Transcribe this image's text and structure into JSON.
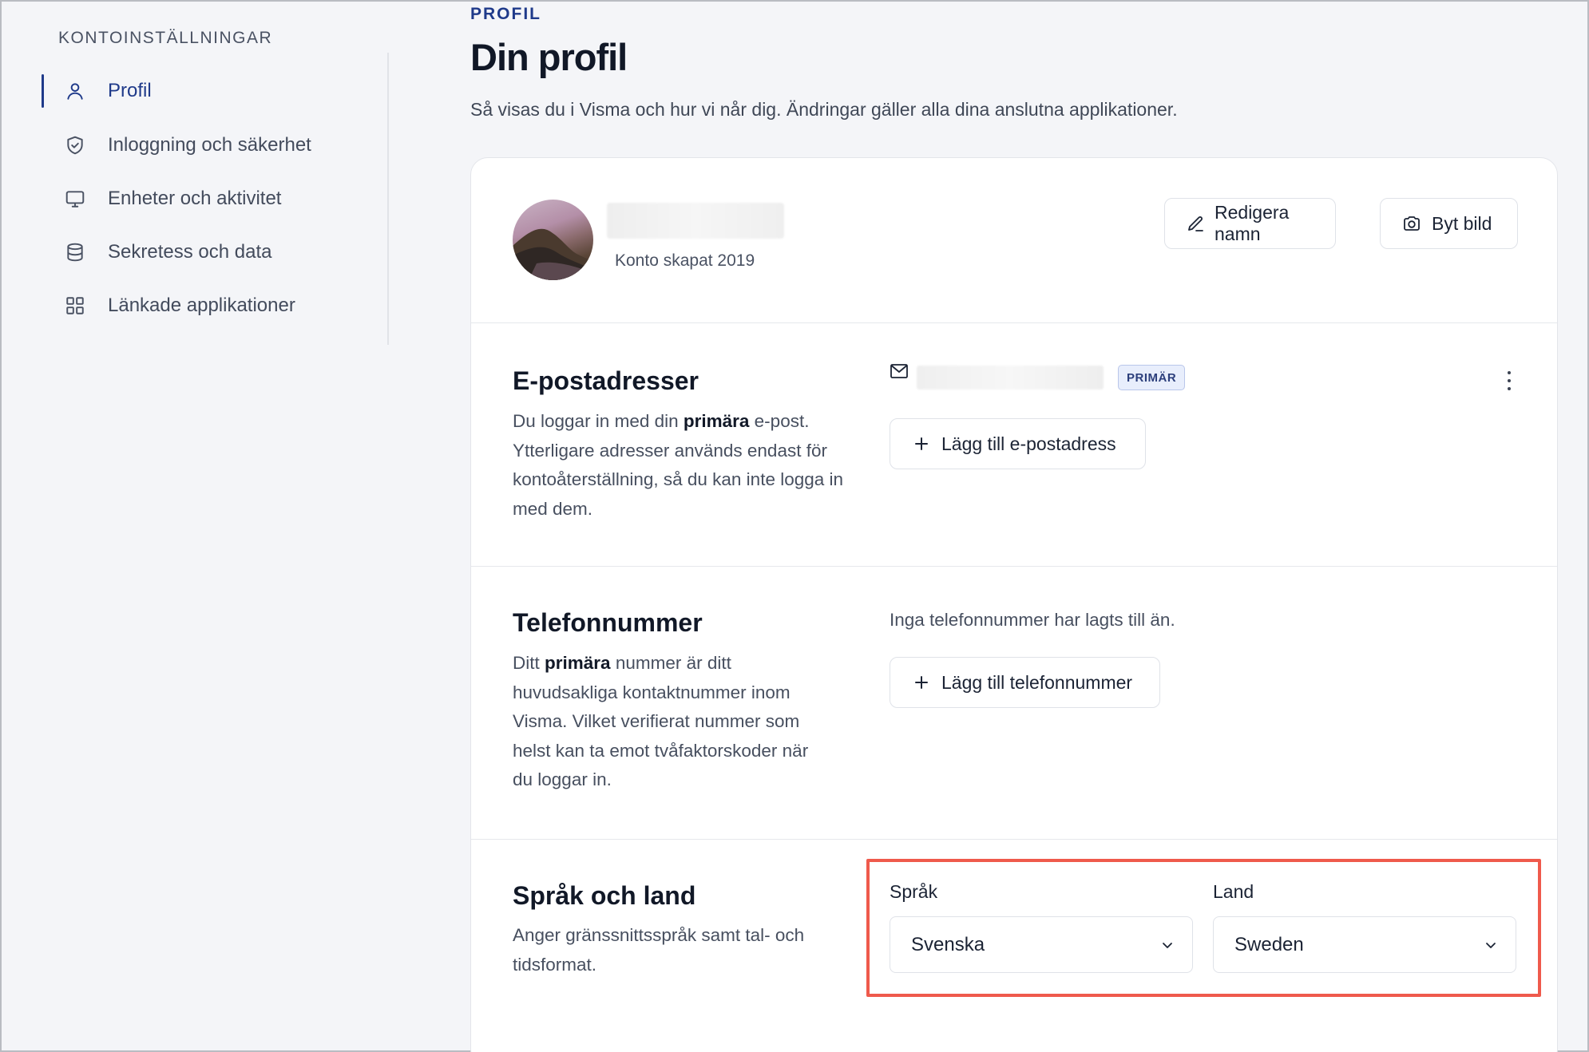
{
  "sidebar": {
    "heading": "KONTOINSTÄLLNINGAR",
    "items": [
      {
        "label": "Profil",
        "icon": "user-icon",
        "active": true
      },
      {
        "label": "Inloggning och säkerhet",
        "icon": "shield-check-icon",
        "active": false
      },
      {
        "label": "Enheter och aktivitet",
        "icon": "monitor-icon",
        "active": false
      },
      {
        "label": "Sekretess och data",
        "icon": "database-icon",
        "active": false
      },
      {
        "label": "Länkade applikationer",
        "icon": "grid-icon",
        "active": false
      }
    ]
  },
  "header": {
    "eyebrow": "PROFIL",
    "title": "Din profil",
    "description": "Så visas du i Visma och hur vi når dig. Ändringar gäller alla dina anslutna applikationer."
  },
  "profile": {
    "account_created": "Konto skapat 2019",
    "edit_name_label": "Redigera namn",
    "change_picture_label": "Byt bild"
  },
  "email": {
    "title": "E-postadresser",
    "desc_before": "Du loggar in med din ",
    "desc_bold": "primära",
    "desc_after": " e-post. Ytterligare adresser används endast för kontoåterställning, så du kan inte logga in med dem.",
    "primary_badge": "PRIMÄR",
    "add_label": "Lägg till e-postadress"
  },
  "phone": {
    "title": "Telefonnummer",
    "desc_before": "Ditt ",
    "desc_bold": "primära",
    "desc_after": " nummer är ditt huvudsakliga kontaktnummer inom Visma. Vilket verifierat nummer som helst kan ta emot tvåfaktorskoder när du loggar in.",
    "empty_text": "Inga telefonnummer har lagts till än.",
    "add_label": "Lägg till telefonnummer"
  },
  "language": {
    "title": "Språk och land",
    "description": "Anger gränssnittsspråk samt tal- och tidsformat.",
    "language_label": "Språk",
    "language_value": "Svenska",
    "country_label": "Land",
    "country_value": "Sweden"
  },
  "colors": {
    "accent": "#1f3a8a",
    "highlight": "#ef5a4c"
  }
}
